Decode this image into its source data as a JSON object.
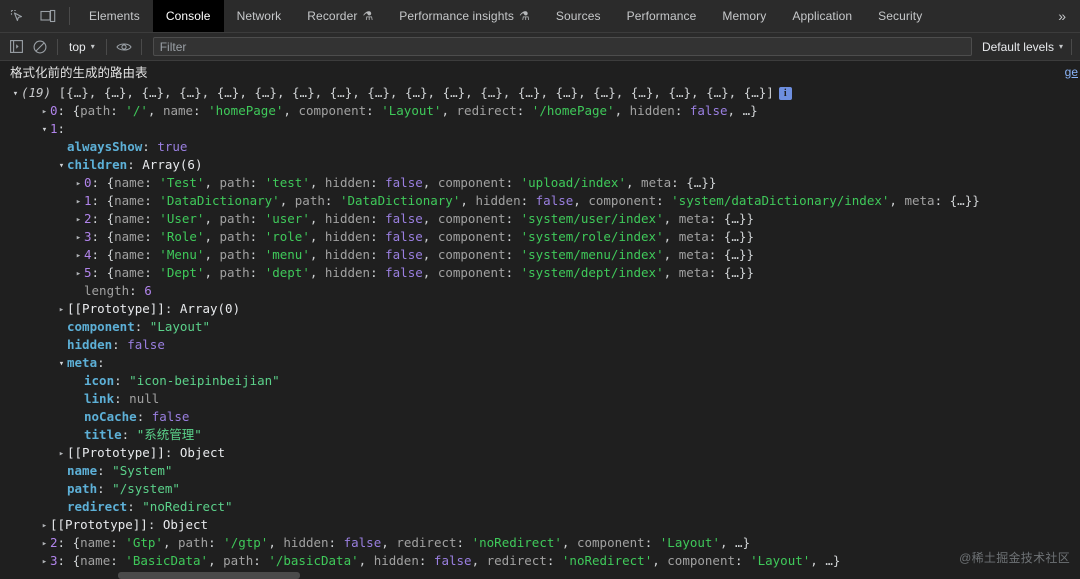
{
  "window": {
    "app": "Chrome DevTools",
    "theme_bg": "#1f1f1f",
    "accent": "#8ab4f8"
  },
  "tabbar": {
    "left_icons": [
      {
        "name": "inspect-element-icon",
        "glyph": "⬚"
      },
      {
        "name": "device-toolbar-icon",
        "glyph": "▭"
      }
    ],
    "tabs": [
      {
        "label": "Elements",
        "active": false,
        "flask": false
      },
      {
        "label": "Console",
        "active": true,
        "flask": false
      },
      {
        "label": "Network",
        "active": false,
        "flask": false
      },
      {
        "label": "Recorder",
        "active": false,
        "flask": true
      },
      {
        "label": "Performance insights",
        "active": false,
        "flask": true
      },
      {
        "label": "Sources",
        "active": false,
        "flask": false
      },
      {
        "label": "Performance",
        "active": false,
        "flask": false
      },
      {
        "label": "Memory",
        "active": false,
        "flask": false
      },
      {
        "label": "Application",
        "active": false,
        "flask": false
      },
      {
        "label": "Security",
        "active": false,
        "flask": false
      }
    ],
    "more_label": "»",
    "flask_glyph": "⚗"
  },
  "toolbar": {
    "sidebar_toggle": "show-console-sidebar-icon",
    "clear_console": "clear-console-icon",
    "context_label": "top",
    "eye_icon": "live-expression-icon",
    "filter_placeholder": "Filter",
    "filter_value": "",
    "levels_label": "Default levels",
    "caret": "▾"
  },
  "console": {
    "message_text": "格式化前的生成的路由表",
    "source_link": "ge",
    "array_count": "(19)",
    "array_preview_items": 19,
    "array_preview_token": "{…}",
    "info_badge": "i",
    "rows": [
      {
        "id": "idx-0",
        "indent": 2,
        "arrow": "closed",
        "key": "0",
        "key_type": "index",
        "preview": "{path: '/', name: 'homePage', component: 'Layout', redirect: '/homePage', hidden: false, …}"
      },
      {
        "id": "idx-1",
        "indent": 2,
        "arrow": "open",
        "key": "1",
        "key_type": "index",
        "preview": ""
      },
      {
        "id": "alwaysShow",
        "indent": 3,
        "arrow": "none",
        "key": "alwaysShow",
        "key_type": "own",
        "value": "true",
        "value_type": "bool"
      },
      {
        "id": "children",
        "indent": 3,
        "arrow": "open",
        "key": "children",
        "key_type": "own",
        "value": "Array(6)",
        "value_type": "arr"
      },
      {
        "id": "child-0",
        "indent": 4,
        "arrow": "closed",
        "key": "0",
        "key_type": "index",
        "preview": "{name: 'Test', path: 'test', hidden: false, component: 'upload/index', meta: {…}}"
      },
      {
        "id": "child-1",
        "indent": 4,
        "arrow": "closed",
        "key": "1",
        "key_type": "index",
        "preview": "{name: 'DataDictionary', path: 'DataDictionary', hidden: false, component: 'system/dataDictionary/index', meta: {…}}"
      },
      {
        "id": "child-2",
        "indent": 4,
        "arrow": "closed",
        "key": "2",
        "key_type": "index",
        "preview": "{name: 'User', path: 'user', hidden: false, component: 'system/user/index', meta: {…}}"
      },
      {
        "id": "child-3",
        "indent": 4,
        "arrow": "closed",
        "key": "3",
        "key_type": "index",
        "preview": "{name: 'Role', path: 'role', hidden: false, component: 'system/role/index', meta: {…}}"
      },
      {
        "id": "child-4",
        "indent": 4,
        "arrow": "closed",
        "key": "4",
        "key_type": "index",
        "preview": "{name: 'Menu', path: 'menu', hidden: false, component: 'system/menu/index', meta: {…}}"
      },
      {
        "id": "child-5",
        "indent": 4,
        "arrow": "closed",
        "key": "5",
        "key_type": "index",
        "preview": "{name: 'Dept', path: 'dept', hidden: false, component: 'system/dept/index', meta: {…}}"
      },
      {
        "id": "children-length",
        "indent": 4,
        "arrow": "none",
        "key": "length",
        "key_type": "dim",
        "value": "6",
        "value_type": "num"
      },
      {
        "id": "children-proto",
        "indent": 3,
        "arrow": "closed",
        "key": "[[Prototype]]",
        "key_type": "proto",
        "value": "Array(0)",
        "value_type": "arr"
      },
      {
        "id": "component",
        "indent": 3,
        "arrow": "none",
        "key": "component",
        "key_type": "own",
        "value": "\"Layout\"",
        "value_type": "str2"
      },
      {
        "id": "hidden",
        "indent": 3,
        "arrow": "none",
        "key": "hidden",
        "key_type": "own",
        "value": "false",
        "value_type": "bool"
      },
      {
        "id": "meta",
        "indent": 3,
        "arrow": "open",
        "key": "meta",
        "key_type": "own",
        "value": "",
        "value_type": "none"
      },
      {
        "id": "meta-icon",
        "indent": 4,
        "arrow": "none",
        "key": "icon",
        "key_type": "own",
        "value": "\"icon-beipinbeijian\"",
        "value_type": "str2"
      },
      {
        "id": "meta-link",
        "indent": 4,
        "arrow": "none",
        "key": "link",
        "key_type": "own",
        "value": "null",
        "value_type": "null"
      },
      {
        "id": "meta-nocache",
        "indent": 4,
        "arrow": "none",
        "key": "noCache",
        "key_type": "own",
        "value": "false",
        "value_type": "bool"
      },
      {
        "id": "meta-title",
        "indent": 4,
        "arrow": "none",
        "key": "title",
        "key_type": "own",
        "value": "\"系统管理\"",
        "value_type": "str2"
      },
      {
        "id": "meta-proto",
        "indent": 3,
        "arrow": "closed",
        "key": "[[Prototype]]",
        "key_type": "proto",
        "value": "Object",
        "value_type": "arr"
      },
      {
        "id": "name",
        "indent": 3,
        "arrow": "none",
        "key": "name",
        "key_type": "own",
        "value": "\"System\"",
        "value_type": "str2"
      },
      {
        "id": "path",
        "indent": 3,
        "arrow": "none",
        "key": "path",
        "key_type": "own",
        "value": "\"/system\"",
        "value_type": "str2"
      },
      {
        "id": "redirect",
        "indent": 3,
        "arrow": "none",
        "key": "redirect",
        "key_type": "own",
        "value": "\"noRedirect\"",
        "value_type": "str2"
      },
      {
        "id": "root-proto",
        "indent": 2,
        "arrow": "closed",
        "key": "[[Prototype]]",
        "key_type": "proto",
        "value": "Object",
        "value_type": "arr"
      },
      {
        "id": "idx-2",
        "indent": 2,
        "arrow": "closed",
        "key": "2",
        "key_type": "index",
        "preview": "{name: 'Gtp', path: '/gtp', hidden: false, redirect: 'noRedirect', component: 'Layout', …}"
      },
      {
        "id": "idx-3",
        "indent": 2,
        "arrow": "closed",
        "key": "3",
        "key_type": "index",
        "preview": "{name: 'BasicData', path: '/basicData', hidden: false, redirect: 'noRedirect', component: 'Layout', …}"
      }
    ]
  },
  "watermark": {
    "text": "@稀土掘金技术社区"
  }
}
